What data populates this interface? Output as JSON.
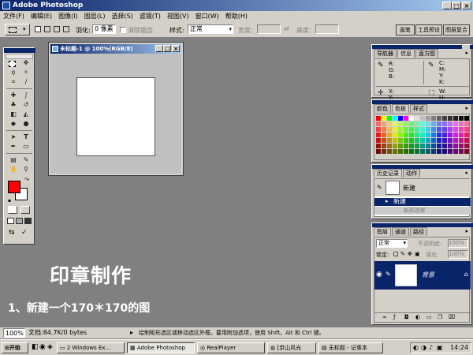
{
  "app": {
    "title": "Adobe Photoshop",
    "window_buttons": [
      "_",
      "□",
      "×"
    ]
  },
  "menu": [
    "文件(F)",
    "编辑(E)",
    "图像(I)",
    "图层(L)",
    "选择(S)",
    "滤镜(T)",
    "视图(V)",
    "窗口(W)",
    "帮助(H)"
  ],
  "options": {
    "feather_label": "羽化:",
    "feather_value": "0 像素",
    "antialias_label": "消除锯齿",
    "style_label": "样式:",
    "style_value": "正常",
    "width_label": "宽度:",
    "height_label": "高度:"
  },
  "palette_tabs": [
    "画笔",
    "工具预设",
    "图层复合"
  ],
  "document": {
    "title": "未标题-1 @ 100%(RGB/8)",
    "buttons": [
      "_",
      "□",
      "×"
    ]
  },
  "colors": {
    "foreground": "#ff0000",
    "background": "#ffffff"
  },
  "navigator": {
    "tabs": [
      "导航器",
      "信息",
      "直方图"
    ],
    "rgb_labels": "R:\nG:\nB:",
    "cmyk_labels": "C:\nM:\nY:\nK:",
    "xy_labels": "X:\nY:",
    "wh_labels": "W:\nH:"
  },
  "color_panel": {
    "tabs": [
      "颜色",
      "色板",
      "样式"
    ]
  },
  "history": {
    "tabs": [
      "历史记录",
      "动作"
    ],
    "snapshot": "新建",
    "items": [
      "新建",
      "矩形选框"
    ]
  },
  "layers": {
    "tabs": [
      "图层",
      "通道",
      "路径"
    ],
    "mode": "正常",
    "opacity_label": "不透明度:",
    "opacity_value": "100%",
    "lock_label": "锁定:",
    "fill_label": "填充:",
    "fill_value": "100%",
    "layer_name": "背景"
  },
  "overlay": {
    "heading": "印章制作",
    "step": "1、新建一个170＊170的图"
  },
  "status": {
    "zoom": "100%",
    "doc": "文档:84.7K/0 bytes",
    "hint": "绘制矩形选区或移动选区外框。要用附加选项，使用 Shift、Alt 和 Ctrl 键。"
  },
  "taskbar": {
    "start": "开始",
    "tasks": [
      "2 Windows Ex...",
      "Adobe Photoshop",
      "RealPlayer",
      "[京山风光",
      "无标题 - 记事本"
    ],
    "clock": "14:24"
  }
}
